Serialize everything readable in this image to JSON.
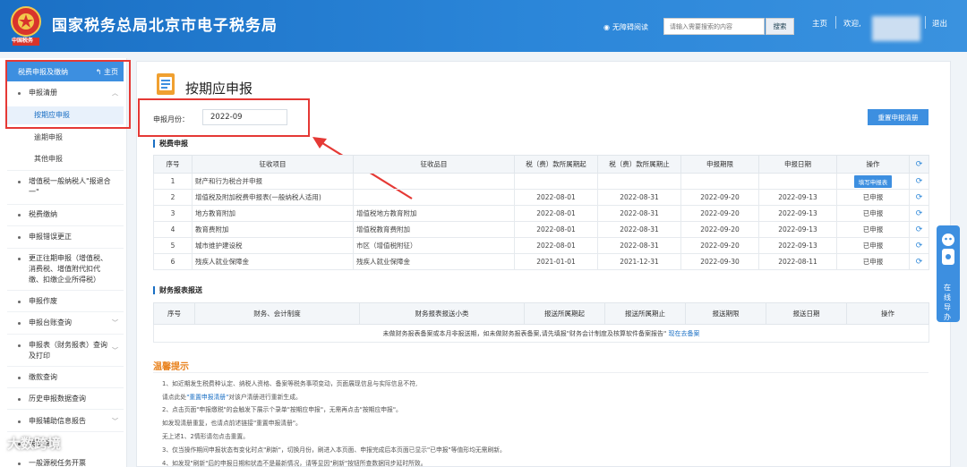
{
  "header": {
    "title": "国家税务总局北京市电子税务局",
    "emblem_text": "中国税务",
    "accessibility": "无障碍阅读",
    "search_placeholder": "请输入需要搜索的内容",
    "search_button": "搜索",
    "home": "主页",
    "welcome": "欢迎,",
    "logout": "退出"
  },
  "sidebar": {
    "head_label": "税费申报及缴纳",
    "head_home": "主页",
    "group_label": "申报清册",
    "subitems": [
      "按期应申报",
      "逾期申报",
      "其他申报"
    ],
    "items": [
      "增值税一般纳税人\"报退合一\"",
      "税费缴纳",
      "申报错误更正",
      "更正往期申报（增值税、消费税、增值附代扣代缴、扣缴企业所得税）",
      "申报作废",
      "申报台账查询",
      "申报表（财务报表）查询及打印",
      "缴款查询",
      "历史申报数据查询",
      "申报辅助信息报告",
      "关联税",
      "一般源税任务开票"
    ]
  },
  "page": {
    "title": "按期应申报",
    "period_label": "申报月份：",
    "period_value": "2022-09",
    "reset_button": "重置申报清册"
  },
  "tax_section": {
    "title": "税费申报",
    "headers": [
      "序号",
      "征收项目",
      "征收品目",
      "税（费）款所属期起",
      "税（费）款所属期止",
      "申报期限",
      "申报日期",
      "操作"
    ],
    "rows": [
      [
        "1",
        "财产和行为税合并申报",
        "",
        "",
        "",
        "",
        "",
        "填写申报表"
      ],
      [
        "2",
        "增值税及附加税费申报表(一般纳税人适用)",
        "",
        "2022-08-01",
        "2022-08-31",
        "2022-09-20",
        "2022-09-13",
        "已申报"
      ],
      [
        "3",
        "地方教育附加",
        "增值税地方教育附加",
        "2022-08-01",
        "2022-08-31",
        "2022-09-20",
        "2022-09-13",
        "已申报"
      ],
      [
        "4",
        "教育费附加",
        "增值税教育费附加",
        "2022-08-01",
        "2022-08-31",
        "2022-09-20",
        "2022-09-13",
        "已申报"
      ],
      [
        "5",
        "城市维护建设税",
        "市区（增值税附征）",
        "2022-08-01",
        "2022-08-31",
        "2022-09-20",
        "2022-09-13",
        "已申报"
      ],
      [
        "6",
        "残疾人就业保障金",
        "残疾人就业保障金",
        "2021-01-01",
        "2021-12-31",
        "2022-09-30",
        "2022-08-11",
        "已申报"
      ]
    ]
  },
  "finance_section": {
    "title": "财务报表报送",
    "headers": [
      "序号",
      "财务、会计制度",
      "财务报表报送小类",
      "报送所属期起",
      "报送所属期止",
      "报送期限",
      "报送日期",
      "操作"
    ],
    "empty_text": "未做财务报表备案或本月非报送期，如未做财务报表备案,请先填报\"财务会计制度及核算软件备案报告\"",
    "empty_link": "现在去备案"
  },
  "notice": {
    "title": "温馨提示",
    "lines": [
      {
        "text": "1、如近期发生税费种认定、纳税人资格、备案等税务事项变动，页面展现信息与实际信息不符,",
        "link": ""
      },
      {
        "text": "请点此处",
        "link": "\"重置申报清册\"",
        "tail": "对该户清册进行重新生成。"
      },
      {
        "text": "2、点击页面\"申报缴税\"的会触发下展示个录单\"按期应申报\"，无需再点击\"按期应申报\"。",
        "link": ""
      },
      {
        "text": "如发现清册重复，也请点前述链接\"重置申报清册\"。",
        "link": ""
      },
      {
        "text": "无上述1、2情形请勿点击重置。",
        "link": ""
      },
      {
        "text": "3、仅当操作期间申报状态有变化时点\"刷新\"，切换月份，刷进入本页面、申报完成后本页面已显示\"已申报\"等值形均无需刷新。",
        "link": ""
      },
      {
        "text": "4、如发现\"刷新\"后的申报日期和状态不是最新情况，请等显因\"刷新\"按钮所查数据同步延时所致。",
        "link": ""
      }
    ]
  },
  "float_tab": "在线导办",
  "watermark": "大数跨境"
}
